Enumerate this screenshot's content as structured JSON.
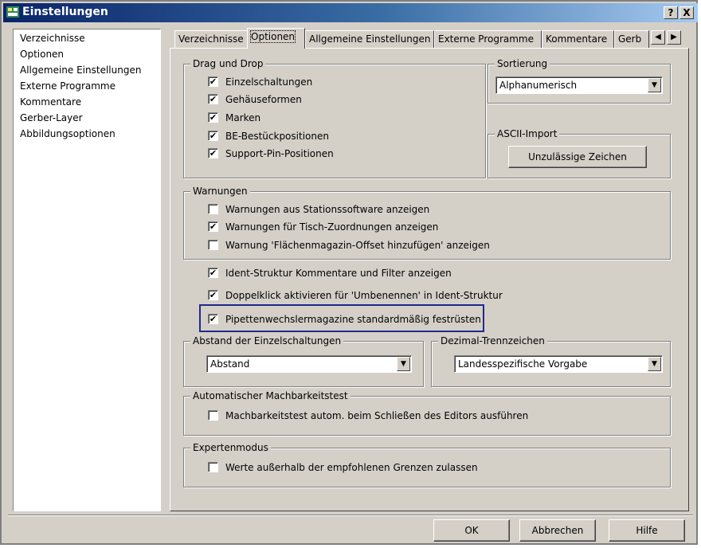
{
  "window": {
    "title": "Einstellungen",
    "help_glyph": "?",
    "close_glyph": "X"
  },
  "nav": {
    "items": [
      "Verzeichnisse",
      "Optionen",
      "Allgemeine Einstellungen",
      "Externe Programme",
      "Kommentare",
      "Gerber-Layer",
      "Abbildungsoptionen"
    ]
  },
  "tabs": {
    "items": [
      "Verzeichnisse",
      "Optionen",
      "Allgemeine Einstellungen",
      "Externe Programme",
      "Kommentare",
      "Gerb"
    ],
    "active": "Optionen",
    "left_glyph": "◀",
    "right_glyph": "▶"
  },
  "drag_drop": {
    "title": "Drag und Drop",
    "options": [
      {
        "label": "Einzelschaltungen",
        "checked": true
      },
      {
        "label": "Gehäuseformen",
        "checked": true
      },
      {
        "label": "Marken",
        "checked": true
      },
      {
        "label": "BE-Bestückpositionen",
        "checked": true
      },
      {
        "label": "Support-Pin-Positionen",
        "checked": true
      }
    ]
  },
  "sortierung": {
    "title": "Sortierung",
    "value": "Alphanumerisch"
  },
  "ascii_import": {
    "title": "ASCII-Import",
    "button": "Unzulässige Zeichen"
  },
  "warnungen": {
    "title": "Warnungen",
    "options": [
      {
        "label": "Warnungen aus Stationssoftware anzeigen",
        "checked": false
      },
      {
        "label": "Warnungen für Tisch-Zuordnungen anzeigen",
        "checked": true
      },
      {
        "label": "Warnung 'Flächenmagazin-Offset hinzufügen' anzeigen",
        "checked": false
      }
    ]
  },
  "general": {
    "options": [
      {
        "label": "Ident-Struktur Kommentare und Filter anzeigen",
        "checked": true
      },
      {
        "label": "Doppelklick aktivieren für 'Umbenennen' in Ident-Struktur",
        "checked": true
      },
      {
        "label": "Pipettenwechslermagazine standardmäßig festrüsten",
        "checked": true
      }
    ]
  },
  "abstand": {
    "title": "Abstand der Einzelschaltungen",
    "value": "Abstand"
  },
  "dezimal": {
    "title": "Dezimal-Trennzeichen",
    "value": "Landesspezifische Vorgabe"
  },
  "machbarkeit": {
    "title": "Automatischer Machbarkeitstest",
    "option": {
      "label": "Machbarkeitstest autom. beim Schließen des Editors ausführen",
      "checked": false
    }
  },
  "experten": {
    "title": "Expertenmodus",
    "option": {
      "label": "Werte außerhalb der empfohlenen Grenzen zulassen",
      "checked": false
    }
  },
  "footer": {
    "ok": "OK",
    "cancel": "Abbrechen",
    "help": "Hilfe"
  },
  "glyphs": {
    "check": "✔",
    "dropdown": "▼"
  },
  "colors": {
    "titlebar_start": "#0a246a",
    "face": "#d4d0c8",
    "highlight_frame": "#1f2a8c"
  }
}
